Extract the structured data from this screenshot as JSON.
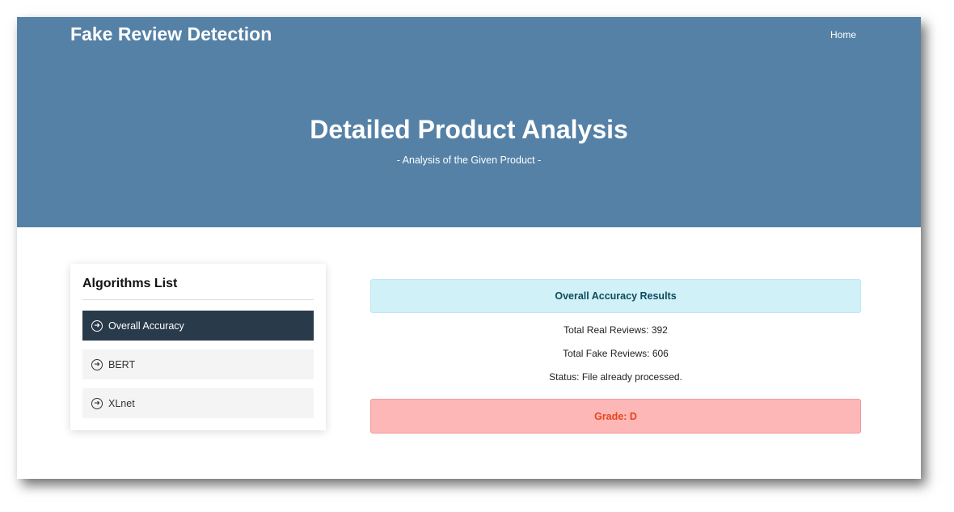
{
  "header": {
    "brand": "Fake Review Detection",
    "nav_home": "Home"
  },
  "hero": {
    "title": "Detailed Product Analysis",
    "subtitle": "- Analysis of the Given Product -"
  },
  "sidebar": {
    "title": "Algorithms List",
    "icon": "arrow-circle-right-icon",
    "items": [
      {
        "label": "Overall Accuracy",
        "active": true
      },
      {
        "label": "BERT",
        "active": false
      },
      {
        "label": "XLnet",
        "active": false
      }
    ]
  },
  "results": {
    "header": "Overall Accuracy Results",
    "total_real": "Total Real Reviews: 392",
    "total_fake": "Total Fake Reviews: 606",
    "status": "Status: File already processed.",
    "grade": "Grade: D"
  },
  "colors": {
    "hero_bg": "#5581a6",
    "active_item_bg": "#293a4a",
    "results_header_bg": "#d0f1f8",
    "grade_bg": "#fdb7b6",
    "grade_text": "#e8441c"
  }
}
